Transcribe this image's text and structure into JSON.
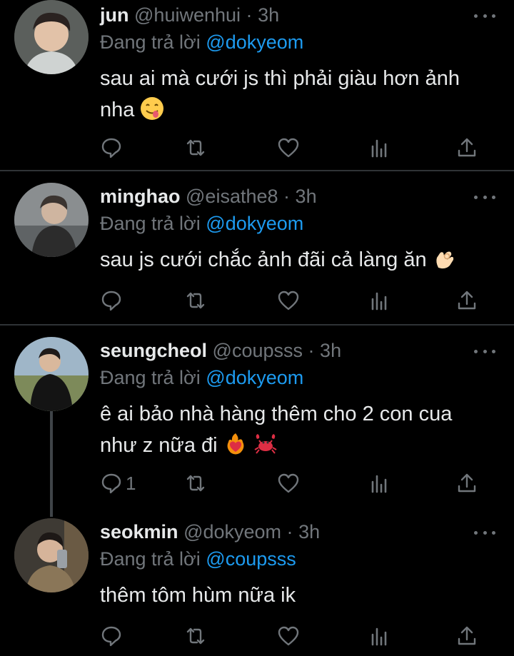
{
  "colors": {
    "background": "#000000",
    "text": "#e7e9ea",
    "muted": "#71767b",
    "mention": "#1d9bf0",
    "divider": "#2f3336"
  },
  "tweets": [
    {
      "name": "jun",
      "handle": "@huiwenhui",
      "dot": "·",
      "time": "3h",
      "reply_prefix": "Đang trả lời",
      "reply_to": "@dokyeom",
      "text_lines": [
        "sau ai mà cưới js thì phải giàu hơn ảnh",
        "nha"
      ],
      "emoji": "face-savoring-food-emoji",
      "reply_count": ""
    },
    {
      "name": "minghao",
      "handle": "@eisathe8",
      "dot": "·",
      "time": "3h",
      "reply_prefix": "Đang trả lời",
      "reply_to": "@dokyeom",
      "text_lines": [
        "sau js cưới chắc ảnh đãi cả làng ăn"
      ],
      "emoji": "ok-hand-emoji",
      "reply_count": ""
    },
    {
      "name": "seungcheol",
      "handle": "@coupsss",
      "dot": "·",
      "time": "3h",
      "reply_prefix": "Đang trả lời",
      "reply_to": "@dokyeom",
      "text_lines": [
        "ê ai bảo nhà hàng thêm cho 2 con cua",
        "như z nữa đi"
      ],
      "emoji": "heart-on-fire-and-crab-emoji",
      "reply_count": "1"
    },
    {
      "name": "seokmin",
      "handle": "@dokyeom",
      "dot": "·",
      "time": "3h",
      "reply_prefix": "Đang trả lời",
      "reply_to": "@coupsss",
      "text_lines": [
        "thêm tôm hùm nữa ik"
      ],
      "emoji": "",
      "reply_count": ""
    }
  ]
}
